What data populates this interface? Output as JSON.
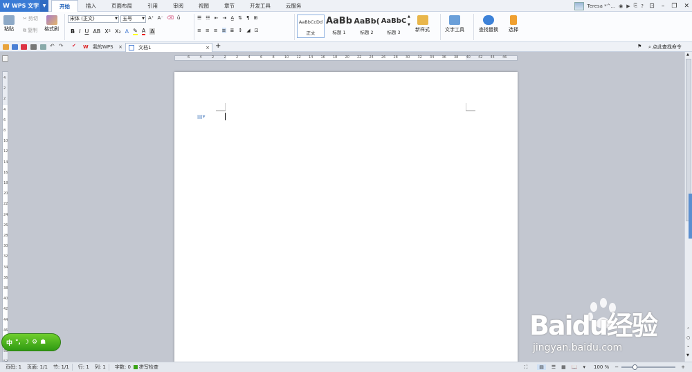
{
  "app": {
    "name": "WPS 文字"
  },
  "menu_tabs": [
    "开始",
    "插入",
    "页面布局",
    "引用",
    "审阅",
    "视图",
    "章节",
    "开发工具",
    "云服务"
  ],
  "user": {
    "name": "Teresa *^..."
  },
  "ribbon": {
    "paste": "粘贴",
    "cut": "剪切",
    "copy": "复制",
    "format_painter": "格式刷",
    "font_name": "宋体 (正文)",
    "font_size": "五号",
    "styles": [
      {
        "preview": "AaBbCcDd",
        "label": "正文"
      },
      {
        "preview": "AaBb",
        "label": "标题 1"
      },
      {
        "preview": "AaBb(",
        "label": "标题 2"
      },
      {
        "preview": "AaBbC",
        "label": "标题 3"
      }
    ],
    "new_style": "新样式",
    "text_tools": "文字工具",
    "find_replace": "查找替换",
    "select": "选择"
  },
  "doc_tabs": [
    {
      "label": "我的WPS"
    },
    {
      "label": "文档1"
    }
  ],
  "search_command": "点此查找命令",
  "ruler": {
    "h_numbers": [
      "6",
      "4",
      "2",
      "2",
      "2",
      "4",
      "6",
      "8",
      "10",
      "12",
      "14",
      "16",
      "18",
      "20",
      "22",
      "24",
      "26",
      "28",
      "30",
      "32",
      "34",
      "36",
      "38",
      "40",
      "42",
      "44",
      "46"
    ],
    "v_numbers": [
      "4",
      "2",
      "2",
      "4",
      "6",
      "8",
      "10",
      "12",
      "14",
      "16",
      "18",
      "20",
      "22",
      "24",
      "26",
      "28",
      "30",
      "32",
      "34",
      "36",
      "38",
      "40",
      "42",
      "44",
      "46",
      "48",
      "50",
      "52"
    ]
  },
  "status": {
    "page_no": "页码: 1",
    "pages": "页面: 1/1",
    "section": "节: 1/1",
    "row": "行: 1",
    "col": "列: 1",
    "words": "字数: 0",
    "spell": "拼写检查",
    "zoom": "100 %"
  },
  "ime": {
    "label": "中"
  },
  "watermark": {
    "brand": "Baidu经验",
    "url": "jingyan.baidu.com"
  },
  "colors": {
    "accent": "#3a7bd5",
    "ime_green": "#3fae18",
    "page": "#ffffff",
    "background": "#c3c7d0"
  }
}
